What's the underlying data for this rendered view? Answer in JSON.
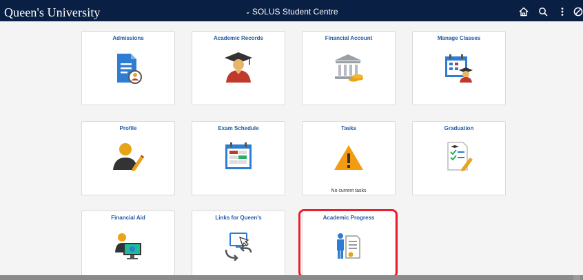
{
  "header": {
    "brand": "Queen's University",
    "title": "SOLUS Student Centre",
    "icons": [
      "home-icon",
      "search-icon",
      "actions-menu-icon",
      "navbar-icon"
    ]
  },
  "tiles": [
    {
      "title": "Admissions",
      "icon": "admissions-document-icon"
    },
    {
      "title": "Academic Records",
      "icon": "graduate-avatar-icon"
    },
    {
      "title": "Financial Account",
      "icon": "bank-coins-icon"
    },
    {
      "title": "Manage Classes",
      "icon": "calendar-student-icon"
    },
    {
      "title": "Profile",
      "icon": "profile-pencil-icon"
    },
    {
      "title": "Exam Schedule",
      "icon": "schedule-calendar-icon"
    },
    {
      "title": "Tasks",
      "icon": "warning-icon",
      "subtitle": "No current tasks"
    },
    {
      "title": "Graduation",
      "icon": "graduation-checklist-icon"
    },
    {
      "title": "Financial Aid",
      "icon": "financial-aid-monitor-icon"
    },
    {
      "title": "Links for Queen's",
      "icon": "links-monitor-icon"
    },
    {
      "title": "Academic Progress",
      "icon": "academic-progress-icon"
    }
  ],
  "colors": {
    "header_bg": "#0a1f44",
    "tile_title": "#1f5aa6",
    "highlight": "#e8202e"
  }
}
